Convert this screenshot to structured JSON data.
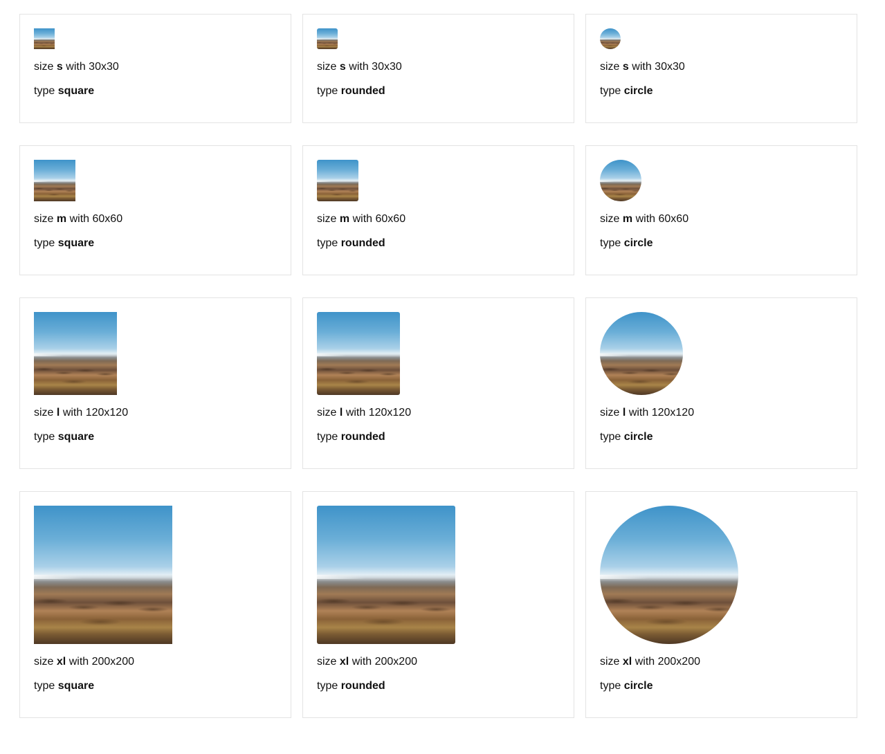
{
  "cards": [
    {
      "size_prefix": "size",
      "size_key": "s",
      "size_suffix": "with 30x30",
      "type_prefix": "type",
      "type_key": "square"
    },
    {
      "size_prefix": "size",
      "size_key": "s",
      "size_suffix": "with 30x30",
      "type_prefix": "type",
      "type_key": "rounded"
    },
    {
      "size_prefix": "size",
      "size_key": "s",
      "size_suffix": "with 30x30",
      "type_prefix": "type",
      "type_key": "circle"
    },
    {
      "size_prefix": "size",
      "size_key": "m",
      "size_suffix": "with 60x60",
      "type_prefix": "type",
      "type_key": "square"
    },
    {
      "size_prefix": "size",
      "size_key": "m",
      "size_suffix": "with 60x60",
      "type_prefix": "type",
      "type_key": "rounded"
    },
    {
      "size_prefix": "size",
      "size_key": "m",
      "size_suffix": "with 60x60",
      "type_prefix": "type",
      "type_key": "circle"
    },
    {
      "size_prefix": "size",
      "size_key": "l",
      "size_suffix": "with 120x120",
      "type_prefix": "type",
      "type_key": "square"
    },
    {
      "size_prefix": "size",
      "size_key": "l",
      "size_suffix": "with 120x120",
      "type_prefix": "type",
      "type_key": "rounded"
    },
    {
      "size_prefix": "size",
      "size_key": "l",
      "size_suffix": "with 120x120",
      "type_prefix": "type",
      "type_key": "circle"
    },
    {
      "size_prefix": "size",
      "size_key": "xl",
      "size_suffix": "with 200x200",
      "type_prefix": "type",
      "type_key": "square"
    },
    {
      "size_prefix": "size",
      "size_key": "xl",
      "size_suffix": "with 200x200",
      "type_prefix": "type",
      "type_key": "rounded"
    },
    {
      "size_prefix": "size",
      "size_key": "xl",
      "size_suffix": "with 200x200",
      "type_prefix": "type",
      "type_key": "circle"
    }
  ],
  "image_subject": "landscape-photo",
  "colors": {
    "card_border": "#e3e3e3",
    "text": "#111111",
    "sky": "#3f93c9",
    "land": "#a07a55"
  }
}
